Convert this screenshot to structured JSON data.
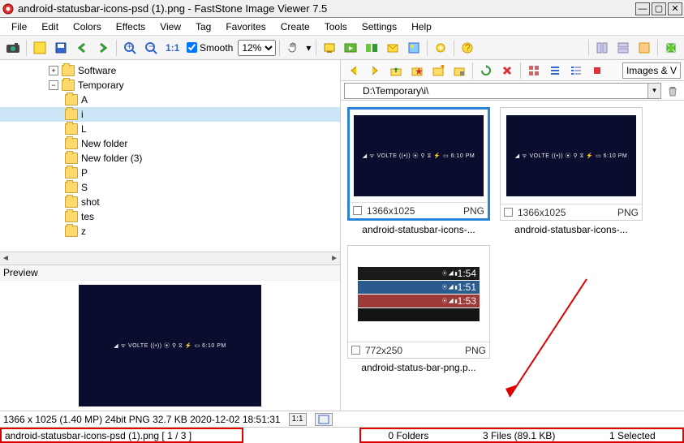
{
  "window": {
    "title": "android-statusbar-icons-psd (1).png  -  FastStone Image Viewer 7.5"
  },
  "menu": [
    "File",
    "Edit",
    "Colors",
    "Effects",
    "View",
    "Tag",
    "Favorites",
    "Create",
    "Tools",
    "Settings",
    "Help"
  ],
  "toolbar": {
    "smooth_label": "Smooth",
    "smooth_checked": true,
    "zoom_value": "12%"
  },
  "tree": {
    "items": [
      {
        "label": "Software",
        "depth": 1,
        "expander": "+"
      },
      {
        "label": "Temporary",
        "depth": 1,
        "expander": "−"
      },
      {
        "label": "A",
        "depth": 2
      },
      {
        "label": "i",
        "depth": 2,
        "selected": true
      },
      {
        "label": "L",
        "depth": 2
      },
      {
        "label": "New folder",
        "depth": 2
      },
      {
        "label": "New folder (3)",
        "depth": 2
      },
      {
        "label": "P",
        "depth": 2
      },
      {
        "label": "S",
        "depth": 2
      },
      {
        "label": "shot",
        "depth": 2
      },
      {
        "label": "tes",
        "depth": 2
      },
      {
        "label": "z",
        "depth": 2
      }
    ]
  },
  "preview": {
    "header": "Preview",
    "simtext": "◢ ᯤ VOLTE ((•)) ⦿ ⚲ ⧖ ⚡ ▭  6:10 PM"
  },
  "right_toolbar": {
    "filter_label": "Images & V"
  },
  "path": {
    "value": "D:\\Temporary\\i\\"
  },
  "thumbs": [
    {
      "caption": "android-statusbar-icons-...",
      "dims": "1366x1025",
      "fmt": "PNG",
      "selected": true,
      "kind": "dark"
    },
    {
      "caption": "android-statusbar-icons-...",
      "dims": "1366x1025",
      "fmt": "PNG",
      "selected": false,
      "kind": "dark"
    },
    {
      "caption": "android-status-bar-png.p...",
      "dims": "772x250",
      "fmt": "PNG",
      "selected": false,
      "kind": "multi"
    }
  ],
  "info1": {
    "text": "1366 x 1025 (1.40 MP)  24bit  PNG   32.7 KB   2020-12-02  18:51:31",
    "ratio": "1:1"
  },
  "info2": {
    "file": "android-statusbar-icons-psd (1).png [ 1 / 3 ]",
    "folders": "0 Folders",
    "files": "3 Files (89.1 KB)",
    "selected": "1 Selected"
  },
  "multirow_times": [
    "1:54",
    "1:51",
    "1:53",
    ""
  ]
}
